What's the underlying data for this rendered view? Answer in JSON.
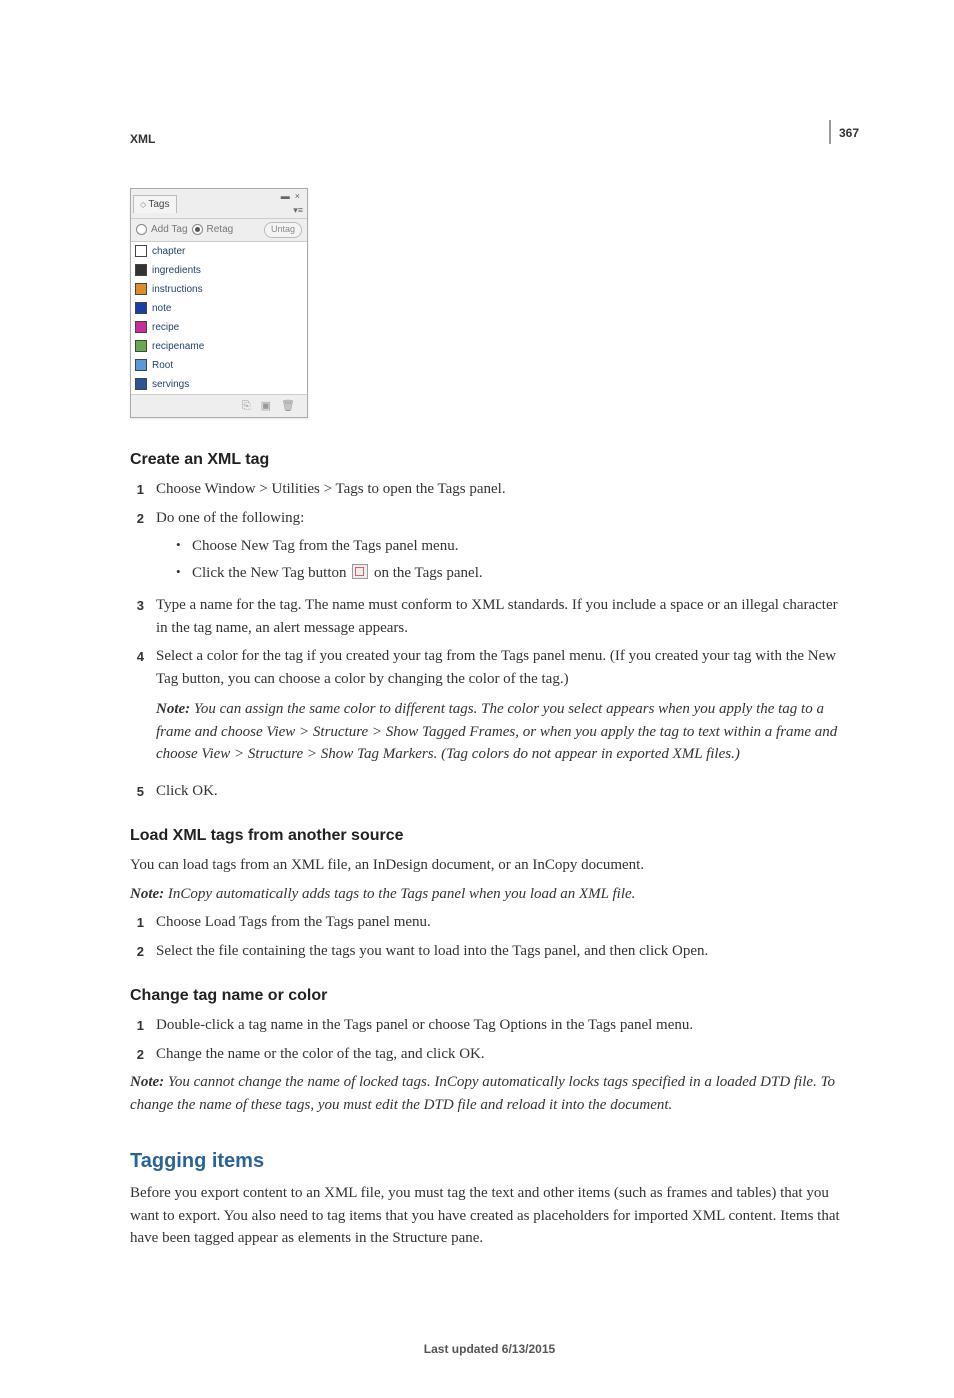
{
  "page_number": "367",
  "breadcrumb": "XML",
  "tags_panel": {
    "title": "Tags",
    "window_controls": "▬  ×\n     ▾≡",
    "add_tag_label": "Add Tag",
    "retag_label": "Retag",
    "untag_label": "Untag",
    "items": [
      {
        "name": "chapter",
        "color": "#d93a2b"
      },
      {
        "name": "ingredients",
        "color": "#333333"
      },
      {
        "name": "instructions",
        "color": "#d98e2b"
      },
      {
        "name": "note",
        "color": "#1a3fa0"
      },
      {
        "name": "recipe",
        "color": "#c62f99"
      },
      {
        "name": "recipename",
        "color": "#6aa84f"
      },
      {
        "name": "Root",
        "color": "#5b9bd5"
      },
      {
        "name": "servings",
        "color": "#2b5597"
      }
    ],
    "bottom_icons": {
      "load": "⎘",
      "new": "▣",
      "delete": "🗑"
    }
  },
  "section1": {
    "heading": "Create an XML tag",
    "step1": "Choose Window > Utilities > Tags to open the Tags panel.",
    "step2_intro": "Do one of the following:",
    "step2_bullet1": "Choose New Tag from the Tags panel menu.",
    "step2_bullet2_a": "Click the New Tag button ",
    "step2_bullet2_b": " on the Tags panel.",
    "step3": "Type a name for the tag. The name must conform to XML standards. If you include a space or an illegal character in the tag name, an alert message appears.",
    "step4": "Select a color for the tag if you created your tag from the Tags panel menu. (If you created your tag with the New Tag button, you can choose a color by changing the color of the tag.)",
    "note_label": "Note:",
    "note_text": " You can assign the same color to different tags. The color you select appears when you apply the tag to a frame and choose View > Structure > Show Tagged Frames, or when you apply the tag to text within a frame and choose View > Structure > Show Tag Markers. (Tag colors do not appear in exported XML files.)",
    "step5": "Click OK."
  },
  "section2": {
    "heading": "Load XML tags from another source",
    "intro": "You can load tags from an XML file, an InDesign document, or an InCopy document.",
    "note_label": "Note:",
    "note_text": " InCopy automatically adds tags to the Tags panel when you load an XML file.",
    "step1": "Choose Load Tags from the Tags panel menu.",
    "step2": "Select the file containing the tags you want to load into the Tags panel, and then click Open."
  },
  "section3": {
    "heading": "Change tag name or color",
    "step1": "Double-click a tag name in the Tags panel or choose Tag Options in the Tags panel menu.",
    "step2": "Change the name or the color of the tag, and click OK.",
    "note_label": "Note:",
    "note_text": " You cannot change the name of locked tags. InCopy automatically locks tags specified in a loaded DTD file. To change the name of these tags, you must edit the DTD file and reload it into the document."
  },
  "tagging_section": {
    "heading": "Tagging items",
    "intro": "Before you export content to an XML file, you must tag the text and other items (such as frames and tables) that you want to export. You also need to tag items that you have created as placeholders for imported XML content. Items that have been tagged appear as elements in the Structure pane."
  },
  "footer": "Last updated 6/13/2015"
}
